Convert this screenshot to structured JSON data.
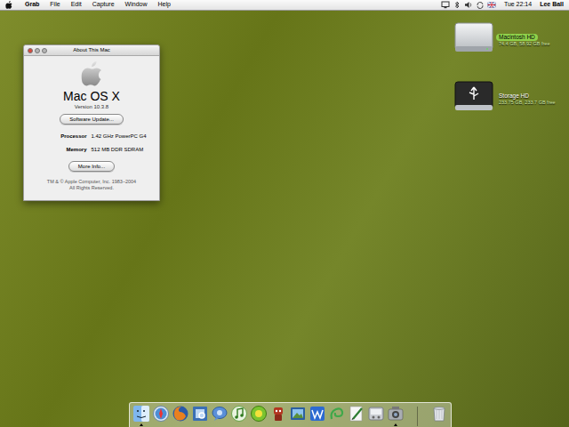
{
  "menu_bar": {
    "app_name": "Grab",
    "menus": [
      "File",
      "Edit",
      "Capture",
      "Window",
      "Help"
    ],
    "extras": [
      {
        "kind": "display"
      },
      {
        "kind": "bluetooth"
      },
      {
        "kind": "volume"
      },
      {
        "kind": "sync"
      },
      {
        "kind": "flag"
      }
    ],
    "clock": "Tue 22:14",
    "user": "Lee Ball"
  },
  "window": {
    "title": "About This Mac",
    "traffic_lights": [
      {
        "color": "#d9483b"
      },
      {
        "color": "#b5b5b5"
      },
      {
        "color": "#b5b5b5"
      }
    ],
    "os_name": "Mac OS X",
    "version": "Version 10.3.8",
    "buttons": [
      "Software Update...",
      "More Info..."
    ],
    "specs": [
      {
        "label": "Processor",
        "value": "1.42 GHz PowerPC G4"
      },
      {
        "label": "Memory",
        "value": "512 MB DDR SDRAM"
      }
    ],
    "copyright": [
      "TM & © Apple Computer, Inc. 1983–2004",
      "All Rights Reserved."
    ]
  },
  "desktop_icons": [
    {
      "name": "Macintosh HD",
      "info": "74.4 GB, 58.92 GB free",
      "kind": "internal",
      "selected": true
    },
    {
      "name": "Storage HD",
      "info": "233.75 GB, 233.7 GB free",
      "kind": "usb",
      "selected": false
    }
  ],
  "dock": {
    "items": [
      {
        "kind": "finder",
        "running": true
      },
      {
        "kind": "safari",
        "running": false
      },
      {
        "kind": "firefox",
        "running": false
      },
      {
        "kind": "preview",
        "running": false
      },
      {
        "kind": "ichat",
        "running": false
      },
      {
        "kind": "itunes",
        "running": false
      },
      {
        "kind": "green",
        "running": false
      },
      {
        "kind": "robot",
        "running": false
      },
      {
        "kind": "photo",
        "running": false
      },
      {
        "kind": "writer",
        "running": false
      },
      {
        "kind": "swirl",
        "running": false
      },
      {
        "kind": "pen",
        "running": false
      },
      {
        "kind": "sysprefs",
        "running": false
      },
      {
        "kind": "grab",
        "running": true
      }
    ],
    "trash": {
      "kind": "trash"
    }
  }
}
